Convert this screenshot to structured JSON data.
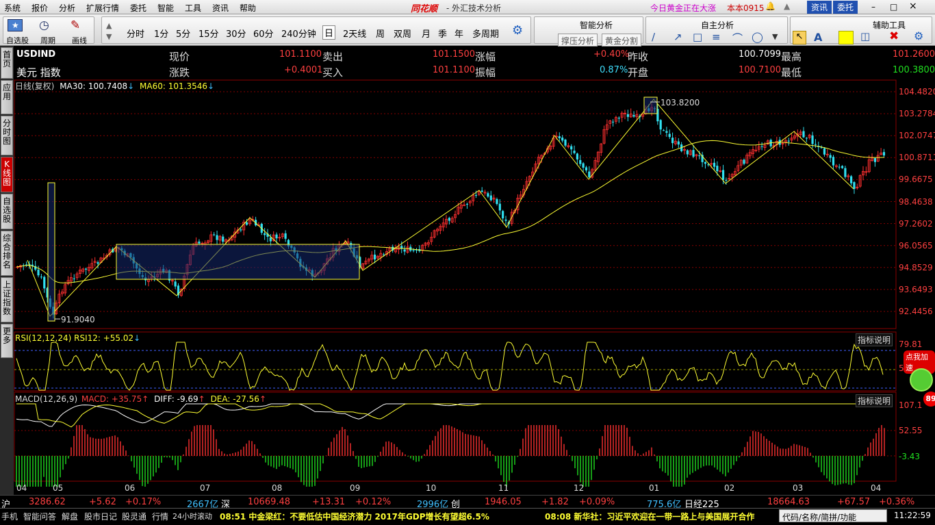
{
  "menubar": {
    "items": [
      "系统",
      "报价",
      "分析",
      "扩展行情",
      "委托",
      "智能",
      "工具",
      "资讯",
      "帮助"
    ],
    "brand": "同花顺",
    "app_title": "- 外汇技术分析",
    "news_ticker": "今日黄金正在大涨",
    "version": "本本0915",
    "btn_news": "资讯",
    "btn_trade": "委托"
  },
  "toolbar": {
    "self_select": "自选股",
    "period_label": "周期",
    "draw_label": "画线",
    "periods": [
      "分时",
      "1分",
      "5分",
      "15分",
      "30分",
      "60分",
      "240分钟",
      "日",
      "2天线",
      "周",
      "双周",
      "月",
      "季",
      "年",
      "多周期"
    ],
    "selected_period": "日",
    "smart_title": "智能分析",
    "support_btn": "撑压分析",
    "gold_btn": "黄金分割",
    "self_title": "自主分析",
    "aux_title": "辅助工具"
  },
  "leftnav": [
    {
      "label": "首页",
      "active": false
    },
    {
      "label": "应用",
      "active": false
    },
    {
      "label": "分时图",
      "active": false
    },
    {
      "label": "K线图",
      "active": true
    },
    {
      "label": "自选股",
      "active": false
    },
    {
      "label": "综合排名",
      "active": false
    },
    {
      "label": "上证指数",
      "active": false
    },
    {
      "label": "更多",
      "active": false
    }
  ],
  "quote": {
    "code": "USDIND",
    "name": "美元 指数",
    "now_label": "现价",
    "now": "101.1100",
    "sell_label": "卖出",
    "sell": "101.1500",
    "pct_label": "涨幅",
    "pct": "+0.40%",
    "yclose_label": "昨收",
    "yclose": "100.7099",
    "high_label": "最高",
    "high": "101.2600",
    "chg_label": "涨跌",
    "chg": "+0.4001",
    "buy_label": "买入",
    "buy": "101.1100",
    "amp_label": "振幅",
    "amp": "0.87%",
    "open_label": "开盘",
    "open": "100.7100",
    "low_label": "最低",
    "low": "100.3800"
  },
  "kline_header": {
    "prefix": "日线(复权)",
    "ma30": "MA30: 100.7408",
    "ma60": "MA60: 101.3546"
  },
  "price_axis": [
    "104.4820",
    "103.2784",
    "102.0747",
    "100.8711",
    "99.6675",
    "98.4638",
    "97.2602",
    "96.0565",
    "94.8529",
    "93.6493",
    "92.4456"
  ],
  "annotations": {
    "high_mark": "103.8200",
    "low_mark": "91.9040"
  },
  "rsi": {
    "label": "RSI(12,12,24)",
    "value": "RSI12: +55.02",
    "help": "指标说明",
    "axis": [
      "79.81",
      "53.30"
    ],
    "promo": "点我加速"
  },
  "macd": {
    "label": "MACD(12,26,9)",
    "macd": "MACD: +35.75",
    "diff": "DIFF: -9.69",
    "dea": "DEA: -27.56",
    "help": "指标说明",
    "axis": [
      "107.1",
      "52.55",
      "-3.43"
    ]
  },
  "badge": "89",
  "x_labels": [
    "04",
    "05",
    "06",
    "07",
    "08",
    "09",
    "10",
    "11",
    "12",
    "01",
    "02",
    "03",
    "04"
  ],
  "status1": {
    "sh": "沪",
    "sh_val": "3286.62",
    "sh_chg": "+5.62",
    "sh_pct": "+0.17%",
    "sh_amt": "2667亿",
    "sz": "深",
    "sz_val": "10669.48",
    "sz_chg": "+13.31",
    "sz_pct": "+0.12%",
    "sz_amt": "2996亿",
    "cy": "创",
    "cy_val": "1946.05",
    "cy_chg": "+1.82",
    "cy_pct": "+0.09%",
    "cy_amt": "775.6亿",
    "rj": "日经225",
    "rj_val": "18664.63",
    "rj_chg": "+67.57",
    "rj_pct": "+0.36%"
  },
  "status2": {
    "tabs": [
      "手机",
      "智能问答",
      "解盘",
      "股市日记",
      "股灵通",
      "行情",
      "24小时滚动"
    ],
    "news1": "08:51 中金梁红：不要低估中国经济潜力 2017年GDP增长有望超6.5%",
    "news2": "08:08 新华社：习近平欢迎在一带一路上与美国展开合作",
    "search": "代码/名称/简拼/功能",
    "time": "11:22:59"
  },
  "colors": {
    "up": "#ff3030",
    "down": "#30e0f0",
    "ma30": "#ffffff",
    "ma60": "#ffff33",
    "grid": "#8a0000"
  }
}
